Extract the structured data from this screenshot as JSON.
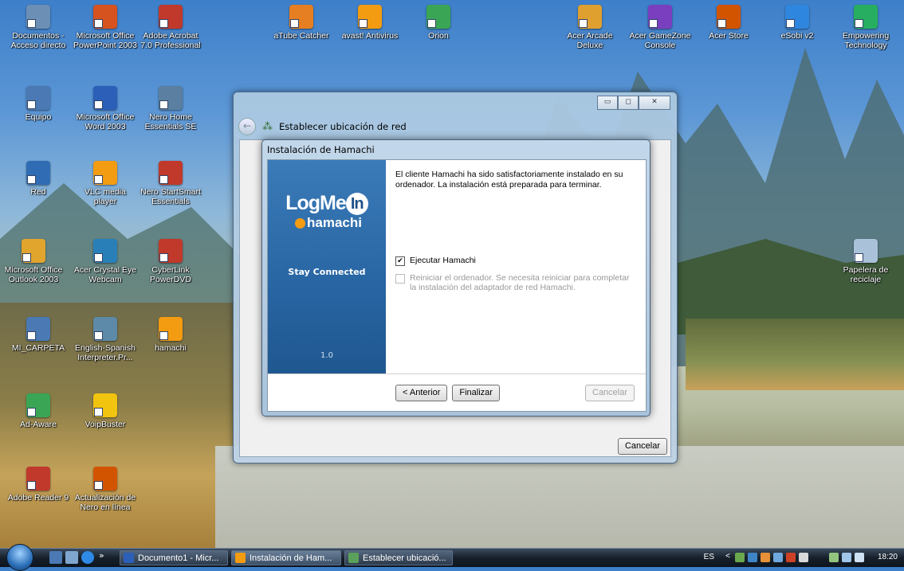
{
  "desktop_icons": [
    {
      "label": "Documentos - Acceso directo",
      "color": "#6b8fb5"
    },
    {
      "label": "Microsoft Office PowerPoint 2003",
      "color": "#d6521e"
    },
    {
      "label": "Adobe Acrobat 7.0 Professional",
      "color": "#c0392b"
    },
    {
      "label": "aTube Catcher",
      "color": "#e67e22"
    },
    {
      "label": "avast! Antivirus",
      "color": "#f39c12"
    },
    {
      "label": "Orion",
      "color": "#3aa655"
    },
    {
      "label": "Acer Arcade Deluxe",
      "color": "#e0a030"
    },
    {
      "label": "Acer GameZone Console",
      "color": "#7a3fbf"
    },
    {
      "label": "Acer Store",
      "color": "#d35400"
    },
    {
      "label": "eSobi v2",
      "color": "#2e86de"
    },
    {
      "label": "Empowering Technology",
      "color": "#27ae60"
    },
    {
      "label": "Equipo",
      "color": "#4a79b3"
    },
    {
      "label": "Microsoft Office Word 2003",
      "color": "#2b5fb8"
    },
    {
      "label": "Nero Home Essentials SE",
      "color": "#5b7fa0"
    },
    {
      "label": "Red",
      "color": "#2f6cb4"
    },
    {
      "label": "VLC media player",
      "color": "#f39c12"
    },
    {
      "label": "Nero StartSmart Essentials",
      "color": "#c0392b"
    },
    {
      "label": "Microsoft Office Outlook 2003",
      "color": "#e1a52e"
    },
    {
      "label": "Acer Crystal Eye Webcam",
      "color": "#2980b9"
    },
    {
      "label": "CyberLink PowerDVD",
      "color": "#c0392b"
    },
    {
      "label": "MI_CARPETA",
      "color": "#4a79b3"
    },
    {
      "label": "English-Spanish Interpreter.Pr...",
      "color": "#5d8aa8"
    },
    {
      "label": "hamachi",
      "color": "#f39c12"
    },
    {
      "label": "Ad-Aware",
      "color": "#3aa655"
    },
    {
      "label": "VoipBuster",
      "color": "#f1c40f"
    },
    {
      "label": "Adobe Reader 9",
      "color": "#c0392b"
    },
    {
      "label": "Actualización de Nero en línea",
      "color": "#d35400"
    },
    {
      "label": "Papelera de reciclaje",
      "color": "#a9c1d9"
    }
  ],
  "outer_window": {
    "title": "Establecer ubicación de red",
    "cancel_label": "Cancelar",
    "back_icon": "back-arrow-icon",
    "minimize": "▭",
    "maximize": "◻",
    "close": "✕"
  },
  "inner_dialog": {
    "title": "Instalación de Hamachi",
    "logo_logmein": "LogMe",
    "logo_in": "In",
    "logo_hamachi": "hamachi",
    "tagline": "Stay Connected",
    "version": "1.0",
    "message": "El cliente Hamachi ha sido satisfactoriamente instalado en su ordenador. La instalación está preparada para terminar.",
    "checkbox_run_label": "Ejecutar Hamachi",
    "checkbox_run_checked": "✔",
    "checkbox_restart_label": "Reiniciar el ordenador. Se necesita reiniciar para completar la instalación del adaptador de red Hamachi.",
    "back_label": "< Anterior",
    "finish_label": "Finalizar",
    "cancel_label": "Cancelar"
  },
  "taskbar": {
    "chevron": "»",
    "tasks": [
      "Documento1 - Micr...",
      "Instalación de Ham...",
      "Establecer ubicació..."
    ],
    "lang": "ES",
    "tray_chevron": "<",
    "clock": "18:20"
  }
}
